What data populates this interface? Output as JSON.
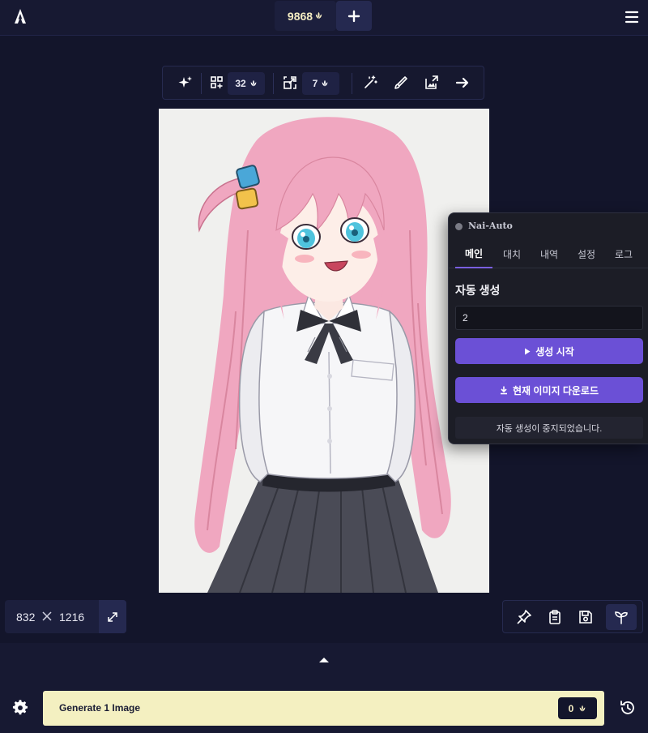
{
  "topbar": {
    "anlas": "9868",
    "logo_icon": "novelai-logo-icon",
    "add_icon": "plus-icon",
    "menu_icon": "hamburger-menu-icon"
  },
  "toolbar": {
    "variations_cost": "32",
    "upscale_cost": "7",
    "icons": [
      "sparkle-icon",
      "variations-icon",
      "upscale-icon",
      "magic-wand-icon",
      "brush-icon",
      "edit-image-icon",
      "arrow-right-icon"
    ]
  },
  "panel": {
    "title": "Nai-Auto",
    "tabs": [
      "메인",
      "대치",
      "내역",
      "설정",
      "로그"
    ],
    "active_tab": "메인",
    "section_title": "자동 생성",
    "count_value": "2",
    "start_button": "생성 시작",
    "download_button": "현재 이미지 다운로드",
    "status": "자동 생성이 중지되었습니다.",
    "accent": "#6b50d6"
  },
  "dimensions": {
    "width": "832",
    "height": "1216"
  },
  "actions": {
    "icons": [
      "pin-icon",
      "clipboard-icon",
      "save-icon",
      "seed-icon"
    ]
  },
  "bottom": {
    "generate_label": "Generate 1 Image",
    "generate_cost": "0",
    "generate_color": "#f4f0c1"
  }
}
